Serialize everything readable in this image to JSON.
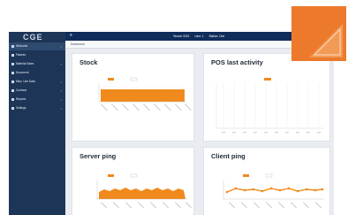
{
  "app": {
    "logo_text": "CGE",
    "breadcrumb": "Dashboard"
  },
  "sidebar": {
    "items": [
      {
        "label": "Welcome",
        "icon": "home-icon",
        "active": true,
        "has_arrow": true
      },
      {
        "label": "Flashes",
        "icon": "bolt-icon",
        "active": false,
        "has_arrow": false
      },
      {
        "label": "Material Sales",
        "icon": "tag-icon",
        "active": false,
        "has_arrow": true
      },
      {
        "label": "Document",
        "icon": "file-icon",
        "active": false,
        "has_arrow": false
      },
      {
        "label": "Misc. Use Data",
        "icon": "database-icon",
        "active": false,
        "has_arrow": true
      },
      {
        "label": "Contract",
        "icon": "contract-icon",
        "active": false,
        "has_arrow": true
      },
      {
        "label": "Reports",
        "icon": "report-icon",
        "active": false,
        "has_arrow": true
      },
      {
        "label": "Settings",
        "icon": "gear-icon",
        "active": false,
        "has_arrow": true
      }
    ]
  },
  "topbar": {
    "tenant": "Tenant: 0001",
    "user": "User: 1",
    "station": "Station: One",
    "buttons": [
      {
        "icon": "list-icon",
        "color": "#ffffff"
      },
      {
        "icon": "grid-icon",
        "color": "#ffffff"
      },
      {
        "icon": "check-icon",
        "color": "#2ea84a"
      },
      {
        "icon": "power-icon",
        "color": "#2ea84a"
      }
    ]
  },
  "cards": {
    "stock": {
      "title": "Stock"
    },
    "pos": {
      "title": "POS last activity"
    },
    "server_ping": {
      "title": "Server ping"
    },
    "client_ping": {
      "title": "Client ping"
    }
  },
  "colors": {
    "sidebar": "#1d3557",
    "topbar": "#0f2c5a",
    "accent": "#ed7a2c",
    "series": "#f08a1c"
  },
  "badge": {
    "icon": "corner-triangle-icon"
  }
}
